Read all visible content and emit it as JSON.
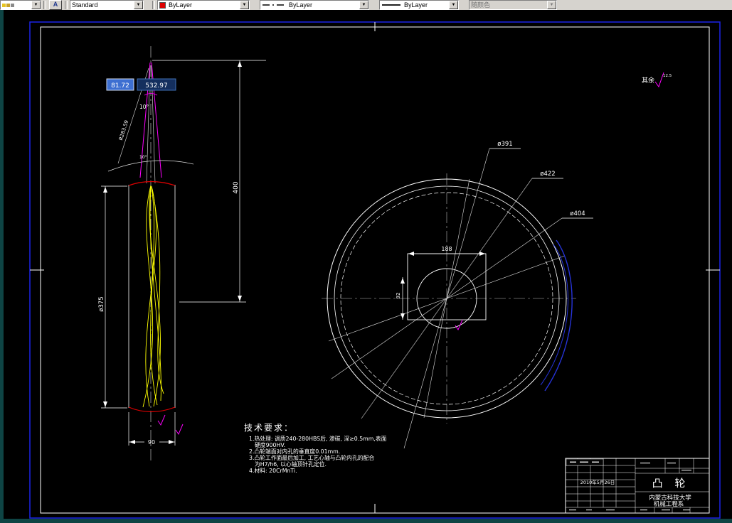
{
  "toolbar": {
    "text_style_button": "A",
    "style_combo": "Standard",
    "color_combo": "ByLayer",
    "linetype_combo": "ByLayer",
    "lineweight_combo": "ByLayer",
    "plotstyle_combo": "随颜色"
  },
  "dynamic_input": {
    "active_value": "81.72",
    "second_value": "532.97"
  },
  "surface_note": {
    "text": "其余",
    "roughness": "12.5"
  },
  "cam_view": {
    "angle_label": "10°",
    "angle_label2": "10°",
    "radius_label": "R283.59",
    "dim_height": "400",
    "dim_diameter": "ø375",
    "dim_width": "90"
  },
  "circle_view": {
    "dia_391": "ø391",
    "dia_422": "ø422",
    "dia_404": "ø404",
    "dim_188": "188",
    "dim_92": "92"
  },
  "tech_requirements": {
    "title": "技术要求：",
    "line1": "1.热处理: 调质240-280HBS后, 渗碳, 深≥0.5mm,表面",
    "line2": "硬度900HV.",
    "line3": "2.凸轮端面对内孔的垂直度0.01mm.",
    "line4": "3.凸轮工作面最后加工, 工艺心轴与凸轮内孔的配合",
    "line5": "为H7/h6, 以心轴顶针孔定位.",
    "line6": "4.材料: 20CrMnTi."
  },
  "title_block": {
    "part_name": "凸  轮",
    "school": "内蒙古科技大学",
    "department": "机械工程系",
    "date": "2010年5月26日"
  },
  "colors": {
    "sheet_border": "#1c24e8",
    "drawing_line": "#ffffff",
    "cam_curves": "#ffff00",
    "construction": "#ff00ff",
    "cam_edge_red": "#dd0000",
    "profile_blue": "#2633d8",
    "toolbar_bg": "#d6d3ce",
    "canvas_bg": "#000000"
  }
}
